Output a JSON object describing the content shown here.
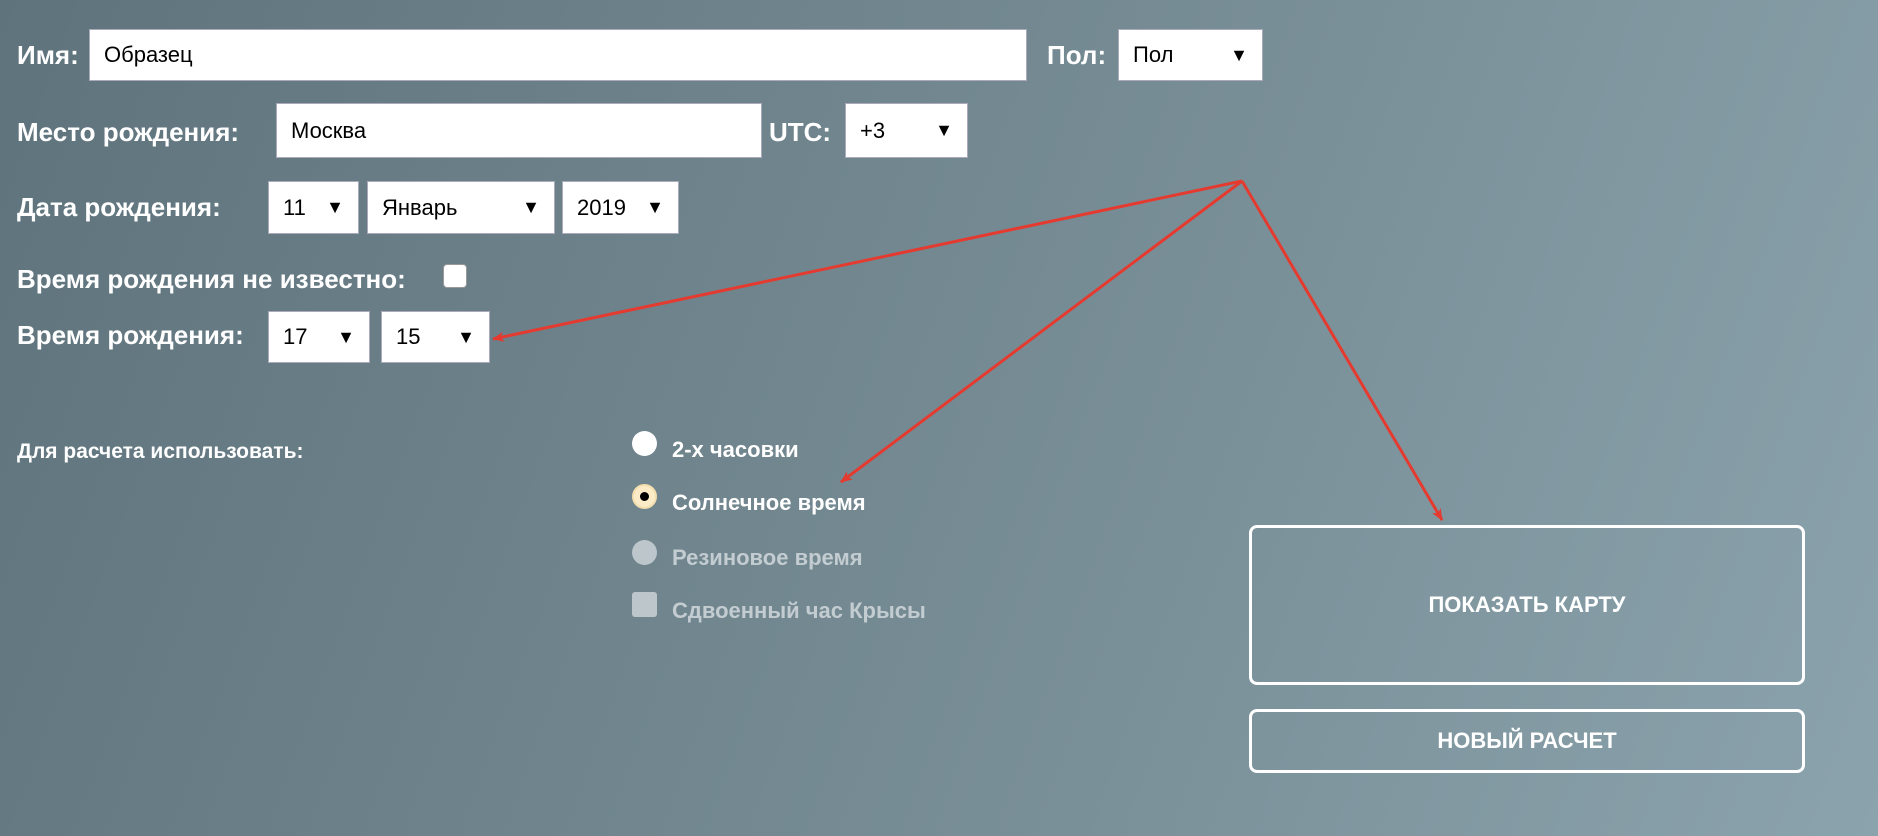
{
  "form": {
    "name_label": "Имя:",
    "name_value": "Образец",
    "gender_label": "Пол:",
    "gender_value": "Пол",
    "birthplace_label": "Место рождения:",
    "birthplace_value": "Москва",
    "utc_label": "UTC:",
    "utc_value": "+3",
    "birthdate_label": "Дата рождения:",
    "day_value": "11",
    "month_value": "Январь",
    "year_value": "2019",
    "time_unknown_label": "Время рождения не известно:",
    "time_unknown_checked": false,
    "birthtime_label": "Время рождения:",
    "hour_value": "17",
    "minute_value": "15",
    "dropdown_arrow": "▼"
  },
  "calc": {
    "label": "Для расчета использовать:",
    "options": [
      {
        "label": "2-х часовки",
        "selected": false,
        "disabled": false
      },
      {
        "label": "Солнечное время",
        "selected": true,
        "disabled": false
      },
      {
        "label": "Резиновое время",
        "selected": false,
        "disabled": true
      },
      {
        "label": "Сдвоенный час Крысы",
        "type": "checkbox",
        "disabled": true
      }
    ]
  },
  "buttons": {
    "show_map": "ПОКАЗАТЬ КАРТУ",
    "new_calc": "НОВЫЙ РАСЧЕТ"
  },
  "colors": {
    "annotation_arrow": "#e53a2f",
    "background_start": "#5f737d",
    "background_end": "#8ba3ad"
  }
}
